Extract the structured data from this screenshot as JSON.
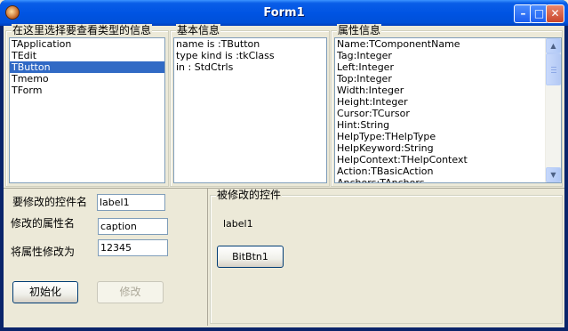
{
  "window": {
    "title": "Form1"
  },
  "groups": {
    "type_select": {
      "caption": "在这里选择要查看类型的信息",
      "items": [
        "TApplication",
        "TEdit",
        "TButton",
        "Tmemo",
        "TForm"
      ],
      "selected_index": 2
    },
    "basic_info": {
      "caption": "基本信息",
      "lines": [
        "name is :TButton",
        "type kind is :tkClass",
        "in : StdCtrls"
      ]
    },
    "property_info": {
      "caption": "属性信息",
      "lines": [
        "Name:TComponentName",
        "Tag:Integer",
        "Left:Integer",
        "Top:Integer",
        "Width:Integer",
        "Height:Integer",
        "Cursor:TCursor",
        "Hint:String",
        "HelpType:THelpType",
        "HelpKeyword:String",
        "HelpContext:THelpContext",
        "Action:TBasicAction",
        "Anchors:TAnchors"
      ]
    }
  },
  "modify": {
    "control_name_label": "要修改的控件名",
    "control_name_value": "label1",
    "property_name_label": "修改的属性名",
    "property_name_value": "caption",
    "new_value_label": "将属性修改为",
    "new_value_value": "12345",
    "init_button": "初始化",
    "modify_button": "修改"
  },
  "target": {
    "caption": "被修改的控件",
    "label_text": "label1",
    "bitbtn_label": "BitBtn1"
  },
  "colors": {
    "selection": "#316ac5",
    "titlebar": "#0054e3",
    "face": "#ece9d8"
  }
}
